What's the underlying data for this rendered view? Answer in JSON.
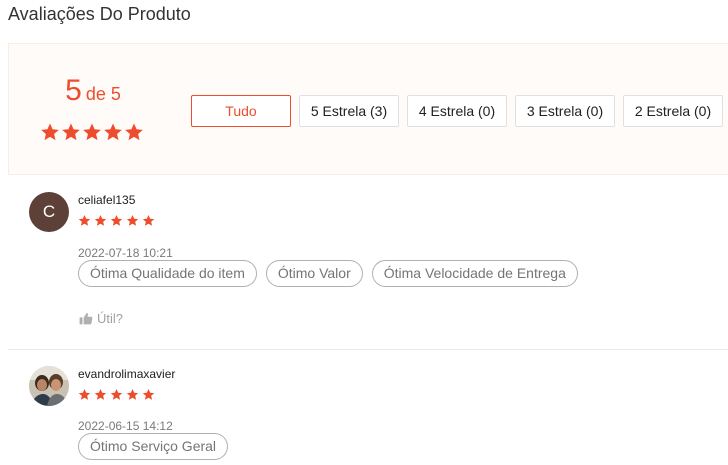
{
  "section_title": "Avaliações Do Produto",
  "rating_overview": {
    "score": "5",
    "out_of": "de 5",
    "stars": 5,
    "filters": [
      {
        "label": "Tudo",
        "active": true
      },
      {
        "label": "5 Estrela (3)",
        "active": false
      },
      {
        "label": "4 Estrela (0)",
        "active": false
      },
      {
        "label": "3 Estrela (0)",
        "active": false
      },
      {
        "label": "2 Estrela (0)",
        "active": false
      }
    ]
  },
  "reviews": [
    {
      "avatar_letter": "C",
      "username": "celiafel135",
      "stars": 5,
      "date": "2022-07-18 10:21",
      "tags": [
        "Ótima Qualidade do item",
        "Ótimo Valor",
        "Ótima Velocidade de Entrega"
      ],
      "helpful_label": "Útil?"
    },
    {
      "avatar_letter": "",
      "username": "evandrolimaxavier",
      "stars": 5,
      "date": "2022-06-15 14:12",
      "tags": [
        "Ótimo Serviço Geral"
      ]
    }
  ],
  "colors": {
    "accent": "#ee4d2d",
    "overview_bg": "#fffbf8",
    "avatar_c": "#5d4037"
  }
}
